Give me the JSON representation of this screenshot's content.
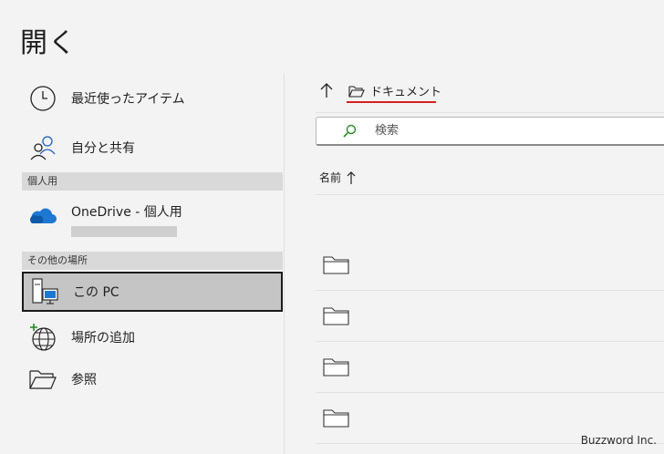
{
  "window": {
    "title": "開く"
  },
  "sidebar": {
    "recent": {
      "label": "最近使ったアイテム",
      "icon": "clock-icon"
    },
    "shared": {
      "label": "自分と共有",
      "icon": "people-icon"
    },
    "section_personal": "個人用",
    "onedrive": {
      "label": "OneDrive - 個人用",
      "icon": "cloud-icon"
    },
    "section_other": "その他の場所",
    "this_pc": {
      "label": "この PC",
      "icon": "pc-icon",
      "selected": true
    },
    "add_place": {
      "label": "場所の追加",
      "icon": "globe-plus-icon"
    },
    "browse": {
      "label": "参照",
      "icon": "folder-open-icon"
    }
  },
  "main": {
    "breadcrumb": {
      "current": "ドキュメント"
    },
    "search": {
      "placeholder": "検索"
    },
    "columns": {
      "name": "名前"
    },
    "rows": [
      {
        "type": "folder"
      },
      {
        "type": "folder"
      },
      {
        "type": "folder"
      },
      {
        "type": "folder"
      }
    ]
  },
  "watermark": "Buzzword Inc.",
  "colors": {
    "accent_underline": "#d42020",
    "onedrive_blue": "#1e78d2",
    "selected_bg": "#c5c5c5"
  }
}
